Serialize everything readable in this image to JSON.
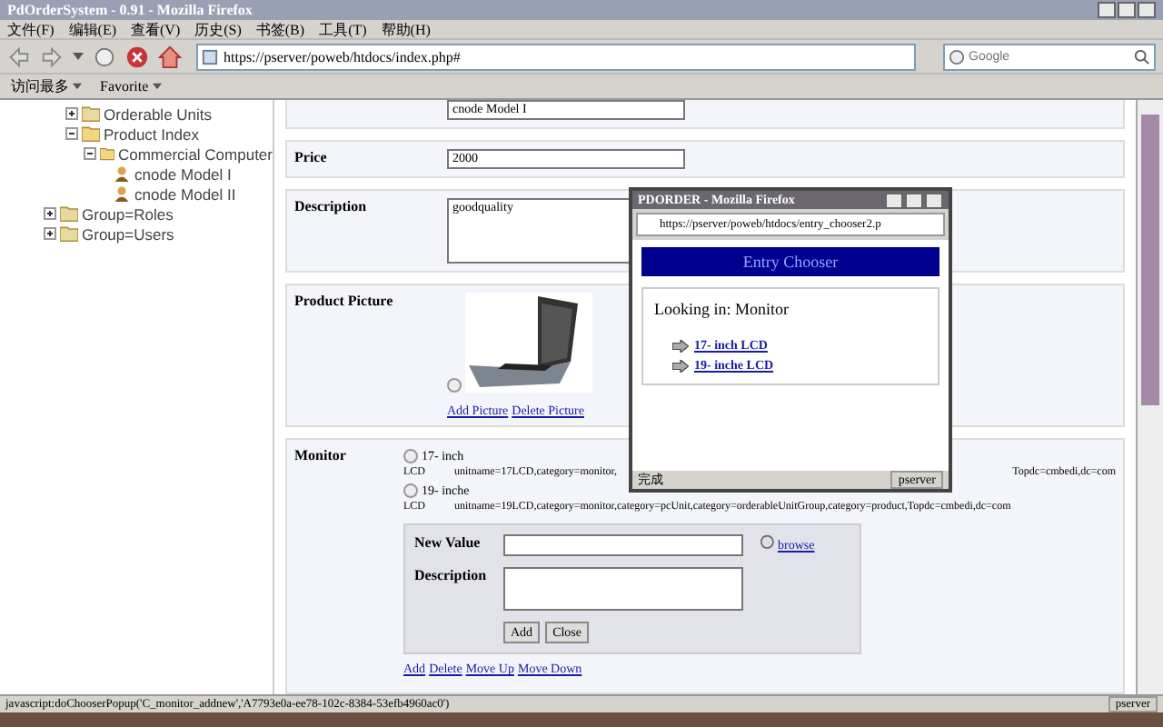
{
  "window": {
    "title": "PdOrderSystem - 0.91 - Mozilla Firefox"
  },
  "menu": [
    "文件(F)",
    "编辑(E)",
    "查看(V)",
    "历史(S)",
    "书签(B)",
    "工具(T)",
    "帮助(H)"
  ],
  "address": {
    "url": "https://pserver/poweb/htdocs/index.php#"
  },
  "search": {
    "placeholder": "Google"
  },
  "bookmarks": [
    "访问最多",
    "Favorite"
  ],
  "tree": [
    {
      "label": "Orderable Units",
      "kind": "folder",
      "expanded": false
    },
    {
      "label": "Product Index",
      "kind": "folder",
      "expanded": true,
      "children": [
        {
          "label": "Commercial Computer",
          "kind": "folder",
          "expanded": true,
          "children": [
            {
              "label": "cnode Model I",
              "kind": "entry"
            },
            {
              "label": "cnode Model II",
              "kind": "entry"
            }
          ]
        }
      ]
    },
    {
      "label": "Group=Roles",
      "kind": "folder",
      "expanded": false
    },
    {
      "label": "Group=Users",
      "kind": "folder",
      "expanded": false
    }
  ],
  "form": {
    "display_value": "cnode Model I",
    "price_label": "Price",
    "price": "2000",
    "description_label": "Description",
    "description": "goodquality",
    "picture_label": "Product Picture",
    "picture_selected": false,
    "picture_links": [
      "Add Picture",
      "Delete Picture"
    ],
    "monitor_label": "Monitor",
    "options": [
      {
        "label": "17- inch",
        "unit": "LCD",
        "dn": "unitname=17LCD,category=monitor,",
        "dn_tail": "Topdc=cmbedi,dc=com",
        "selected": false
      },
      {
        "label": "19- inche",
        "unit": "LCD",
        "dn": "unitname=19LCD,category=monitor,category=pcUnit,category=orderableUnitGroup,category=product,Topdc=cmbedi,dc=com",
        "selected": false
      }
    ],
    "new_value_label": "New Value",
    "new_desc_label": "Description",
    "browse": "browse",
    "buttons": [
      "Add",
      "Close"
    ],
    "actions": [
      "Add",
      "Delete",
      "Move Up",
      "Move Down"
    ]
  },
  "status_bar": {
    "text": "javascript:doChooserPopup('C_monitor_addnew','A7793e0a-ee78-102c-8384-53efb4960ac0')",
    "server": "pserver"
  },
  "popup": {
    "title": "PDORDER - Mozilla Firefox",
    "url": "https://pserver/poweb/htdocs/entry_chooser2.p",
    "heading": "Entry Chooser",
    "looking": "Looking in: Monitor",
    "links": [
      "17- inch LCD",
      "19- inche LCD"
    ],
    "status": "完成",
    "server": "pserver"
  }
}
